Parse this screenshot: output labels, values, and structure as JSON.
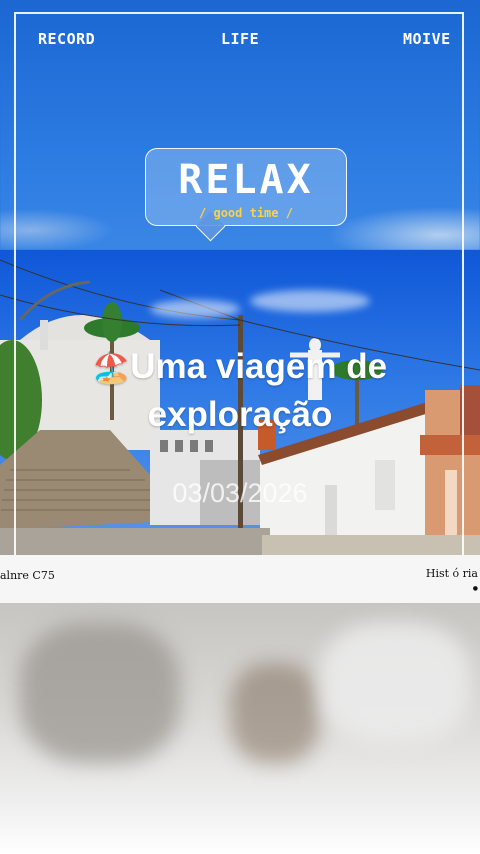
{
  "nav": {
    "left": "RECORD",
    "center": "LIFE",
    "right": "MOIVE"
  },
  "badge": {
    "title": "RELAX",
    "subtitle": "/ good time /"
  },
  "caption": {
    "emoji": "🏖️",
    "line1": "Uma viagem de",
    "line2": "exploração"
  },
  "date": "03/03/2026",
  "strip": {
    "left": "alnre C75",
    "right": "Hist ó ria",
    "dot": "●"
  },
  "colors": {
    "sky": "#1f6ed6",
    "badge_accent": "#f7d34a",
    "frame": "#ffffff"
  }
}
